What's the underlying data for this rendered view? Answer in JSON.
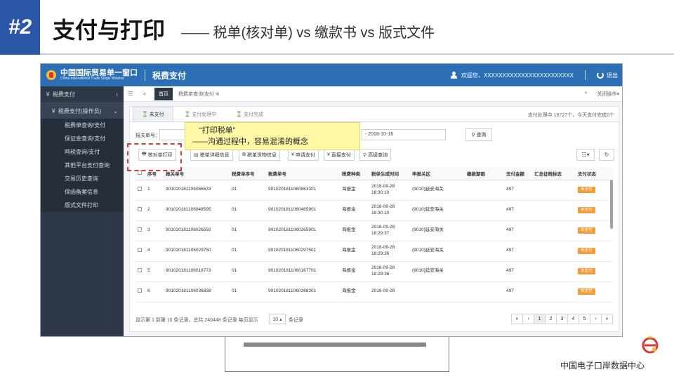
{
  "slide": {
    "number": "#2",
    "title": "支付与打印",
    "subtitle": "—— 税单(核对单) vs 缴款书 vs 版式文件"
  },
  "app": {
    "logo_cn": "中国国际贸易单一窗口",
    "logo_en": "China International Trade Single Window",
    "module": "税费支付",
    "welcome": "欢迎您，",
    "username": "XXXXXXXXXXXXXXXXXXXXXXXX",
    "logout": "退出"
  },
  "sidebar": {
    "group": "税费支付",
    "sub": "税费支付(操作员)",
    "items": [
      "税费单查询/支付",
      "保证金查询/支付",
      "鸣税查询/支付",
      "其他平台支付查询",
      "交易历史查询",
      "保函备案信息",
      "版式文件打印"
    ]
  },
  "tabbar": {
    "home": "首页",
    "current": "税费单查询/支付",
    "close": "⊗",
    "right_label": "关闭操作▾"
  },
  "status_tabs": [
    "未支付",
    "支付处理中",
    "支付完成"
  ],
  "status_summary": "支付处理中 16727个，今天支付完成0个",
  "search": {
    "label": "报关单号：",
    "date_range": "- 2018-10-16",
    "button": "查询"
  },
  "callout": {
    "line1": "“打印税单”",
    "line2": "——沟通过程中，容易混淆的概念"
  },
  "actions": [
    {
      "icon": "🖶",
      "label": "核对单打印"
    },
    {
      "icon": "▤",
      "label": "税单详细信息"
    },
    {
      "icon": "⧉",
      "label": "税单货物信息"
    },
    {
      "icon": "¥",
      "label": "申请支付"
    },
    {
      "icon": "¥",
      "label": "直接支付"
    },
    {
      "icon": "⚲",
      "label": "高级查询"
    }
  ],
  "table": {
    "columns": [
      "",
      "序号",
      "报关单号",
      "税费单序号",
      "税费单号",
      "税费种类",
      "税单生成时间",
      "申报关区",
      "缴款期限",
      "支付金额",
      "汇总征税标志",
      "支付状态"
    ],
    "rows": [
      [
        "1",
        "901020181106066633",
        "01",
        "9010201811060663301",
        "海报金",
        "2018-09-28\n18:30:10",
        "(9010)延安海关",
        "",
        "497",
        "",
        "未支付"
      ],
      [
        "2",
        "901020181106048595",
        "01",
        "9010201811060485901",
        "海报金",
        "2018-09-28\n18:30:10",
        "(9010)延安海关",
        "",
        "497",
        "",
        "未支付"
      ],
      [
        "3",
        "901020181106026592",
        "01",
        "9010201811060265901",
        "海报金",
        "2018-09-28\n18:29:37",
        "(9010)延安海关",
        "",
        "497",
        "",
        "未支付"
      ],
      [
        "4",
        "901020181106029750",
        "01",
        "9010201811060297501",
        "海报金",
        "2018-09-28\n18:29:36",
        "(9010)延安海关",
        "",
        "497",
        "",
        "未支付"
      ],
      [
        "5",
        "901020181106016773",
        "01",
        "9010201811060167701",
        "海报金",
        "2018-09-28\n18:29:36",
        "(9010)延安海关",
        "",
        "497",
        "",
        "未支付"
      ],
      [
        "6",
        "901020181106036838",
        "01",
        "9010201811060368301",
        "海报金",
        "2018-09-28",
        "",
        "",
        "497",
        "",
        "未支付"
      ]
    ]
  },
  "footer": {
    "info": "显示第 1 到第 10 条记录，总共 240448 条记录 每页显示",
    "page_size": "10 ▴",
    "page_size_suffix": "条记录",
    "pages": [
      "«",
      "‹",
      "1",
      "2",
      "3",
      "4",
      "5",
      "›",
      "»"
    ]
  },
  "brand": {
    "text": "中国电子口岸数据中心"
  }
}
